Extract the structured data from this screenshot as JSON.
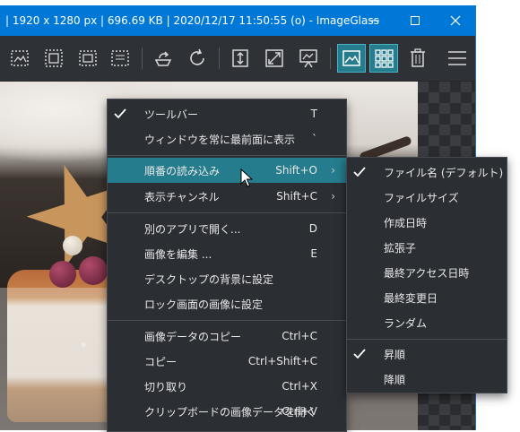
{
  "window": {
    "title": "| 1920 x 1280 px | 696.69 KB | 2020/12/17 11:50:55 (o) - ImageGlass",
    "controls": {
      "minimize": "—",
      "maximize": "☐",
      "close": "✕"
    }
  },
  "toolbar": {
    "buttons": [
      {
        "icon": "view-prev-image-icon"
      },
      {
        "icon": "view-frame-image-icon"
      },
      {
        "icon": "view-next-image-icon"
      },
      {
        "icon": "view-actual-image-icon"
      },
      {
        "icon": "rotate-left-icon"
      },
      {
        "icon": "refresh-icon"
      },
      {
        "icon": "fit-height-icon"
      },
      {
        "icon": "zoom-fit-icon"
      },
      {
        "icon": "slideshow-icon"
      },
      {
        "icon": "gallery-view-icon",
        "active": true
      },
      {
        "icon": "thumbnail-grid-icon",
        "active": true
      },
      {
        "icon": "delete-trash-icon"
      },
      {
        "icon": "hamburger-menu-icon"
      }
    ],
    "accent": "#257c8c"
  },
  "main_menu": {
    "items": [
      {
        "label": "ツールバー",
        "shortcut": "T",
        "checked": true
      },
      {
        "label": "ウィンドウを常に最前面に表示",
        "shortcut": "`"
      },
      {
        "label": "順番の読み込み",
        "shortcut": "Shift+O",
        "submenu": true,
        "highlighted": true
      },
      {
        "label": "表示チャンネル",
        "shortcut": "Shift+C",
        "submenu": true
      },
      {
        "label": "別のアプリで開く...",
        "shortcut": "D"
      },
      {
        "label": "画像を編集 ...",
        "shortcut": "E"
      },
      {
        "label": "デスクトップの背景に設定",
        "shortcut": ""
      },
      {
        "label": "ロック画面の画像に設定",
        "shortcut": ""
      },
      {
        "label": "画像データのコピー",
        "shortcut": "Ctrl+C"
      },
      {
        "label": "コピー",
        "shortcut": "Ctrl+Shift+C"
      },
      {
        "label": "切り取り",
        "shortcut": "Ctrl+X"
      },
      {
        "label": "クリップボードの画像データを開く",
        "shortcut": "Ctrl+V"
      }
    ]
  },
  "sort_submenu": {
    "items": [
      {
        "label": "ファイル名 (デフォルト)",
        "checked": true
      },
      {
        "label": "ファイルサイズ"
      },
      {
        "label": "作成日時"
      },
      {
        "label": "拡張子"
      },
      {
        "label": "最終アクセス日時"
      },
      {
        "label": "最終変更日"
      },
      {
        "label": "ランダム"
      },
      {
        "label": "昇順",
        "checked": true
      },
      {
        "label": "降順"
      }
    ]
  },
  "colors": {
    "titlebar": "#0078d7",
    "menu_bg": "#2b2e33",
    "highlight": "#257c8c",
    "menu_text": "#e8e8e8"
  }
}
